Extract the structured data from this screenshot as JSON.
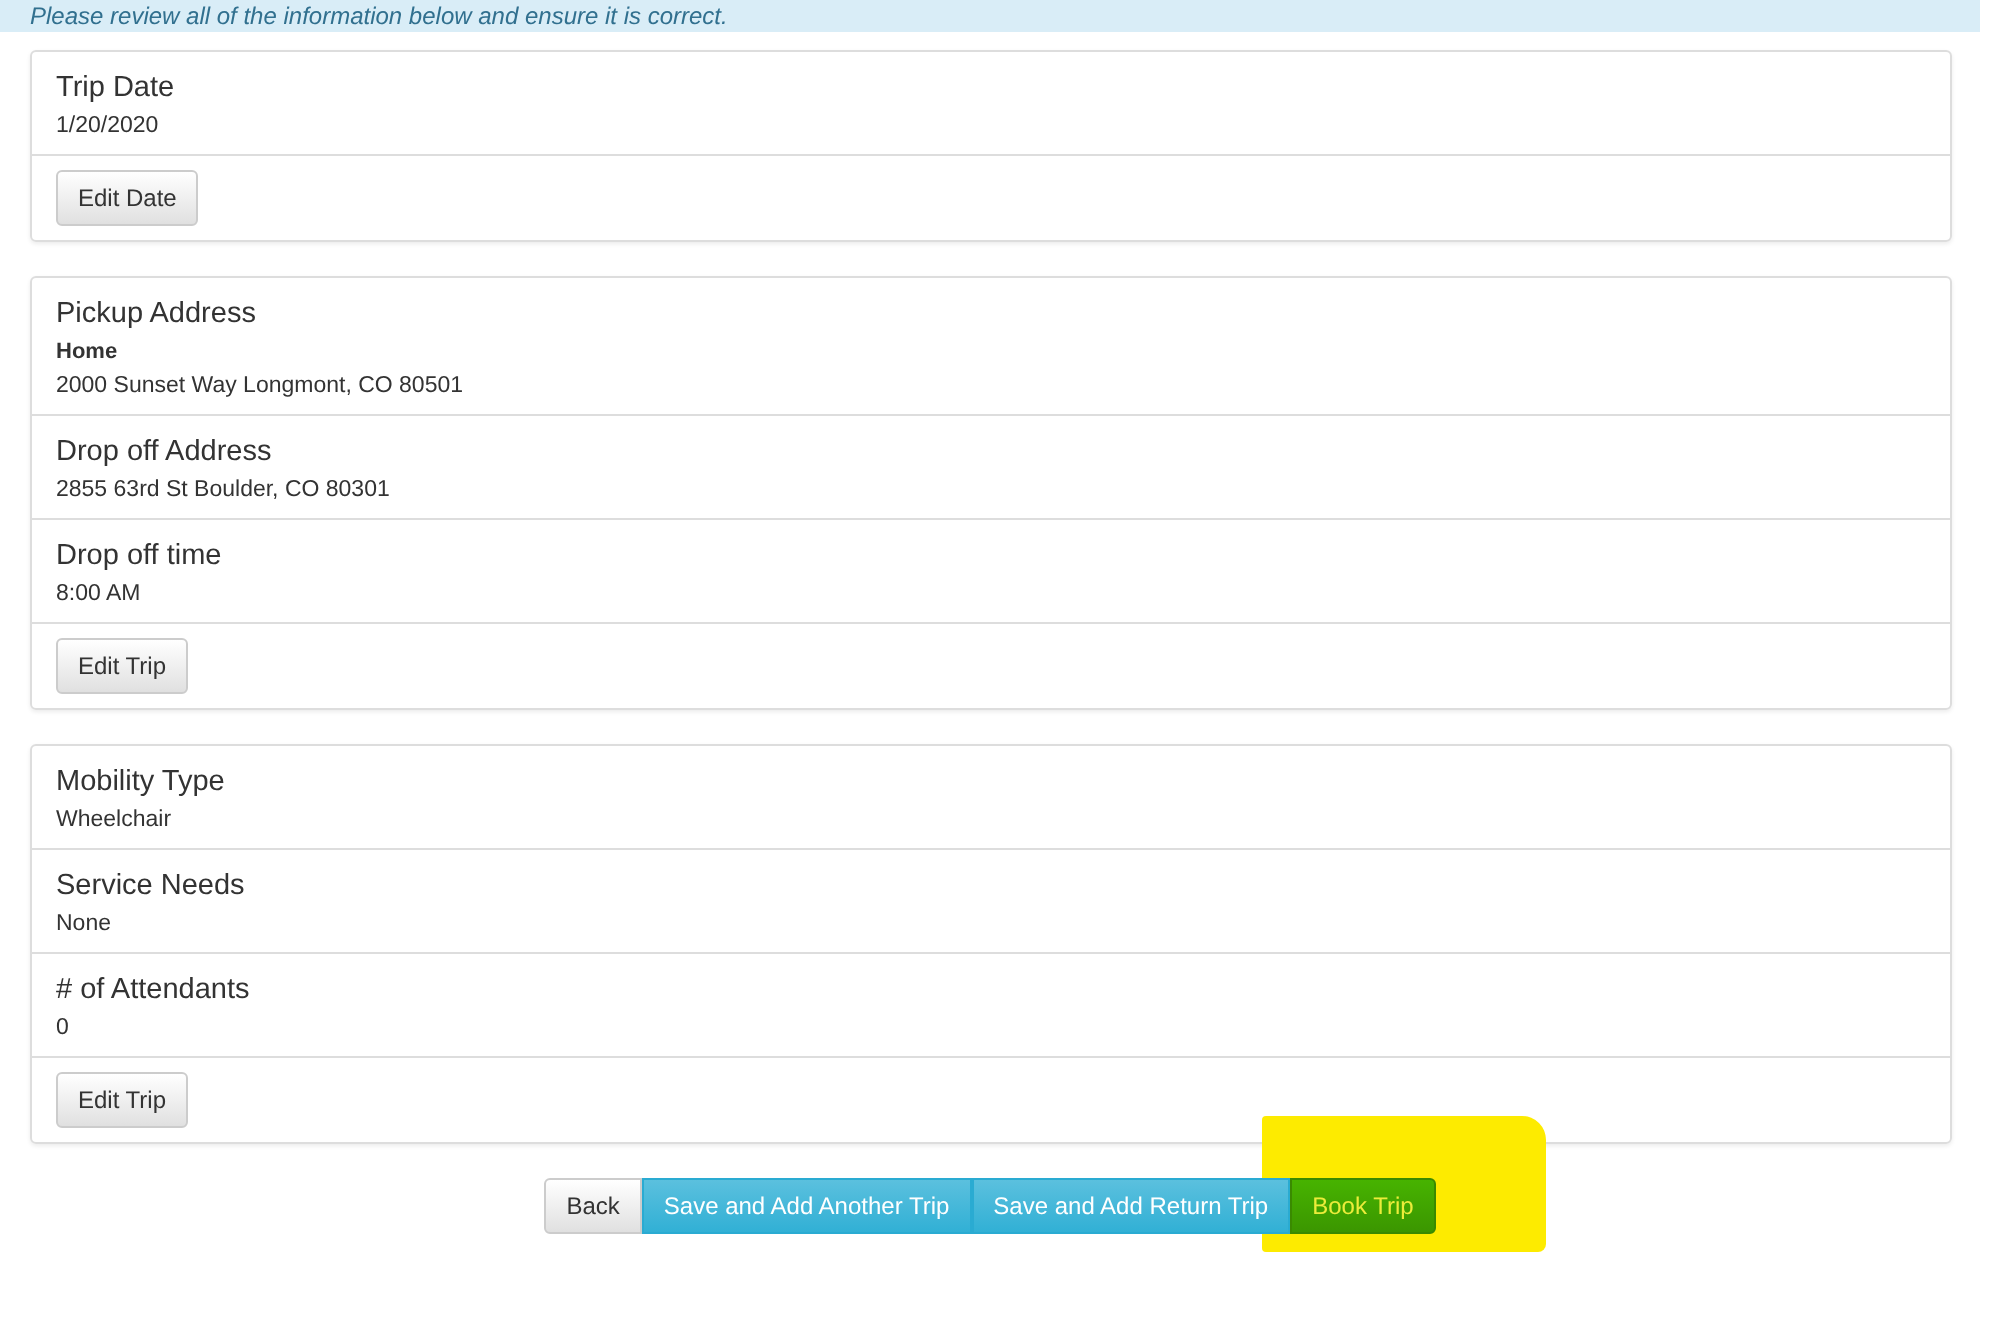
{
  "notice": "Please review all of the information below and ensure it is correct.",
  "panels": [
    {
      "sections": [
        {
          "title": "Trip Date",
          "value": "1/20/2020"
        }
      ],
      "button": "Edit Date"
    },
    {
      "sections": [
        {
          "title": "Pickup Address",
          "subtitle": "Home",
          "value": "2000 Sunset Way Longmont, CO 80501"
        },
        {
          "title": "Drop off Address",
          "value": "2855 63rd St Boulder, CO 80301"
        },
        {
          "title": "Drop off time",
          "value": "8:00 AM"
        }
      ],
      "button": "Edit Trip"
    },
    {
      "sections": [
        {
          "title": "Mobility Type",
          "value": "Wheelchair"
        },
        {
          "title": "Service Needs",
          "value": "None"
        },
        {
          "title": "# of Attendants",
          "value": "0"
        }
      ],
      "button": "Edit Trip"
    }
  ],
  "actions": [
    {
      "label": "Back",
      "kind": "default",
      "highlighted": false
    },
    {
      "label": "Save and Add Another Trip",
      "kind": "info",
      "highlighted": false
    },
    {
      "label": "Save and Add Return Trip",
      "kind": "info",
      "highlighted": false
    },
    {
      "label": "Book Trip",
      "kind": "success",
      "highlighted": true
    }
  ]
}
